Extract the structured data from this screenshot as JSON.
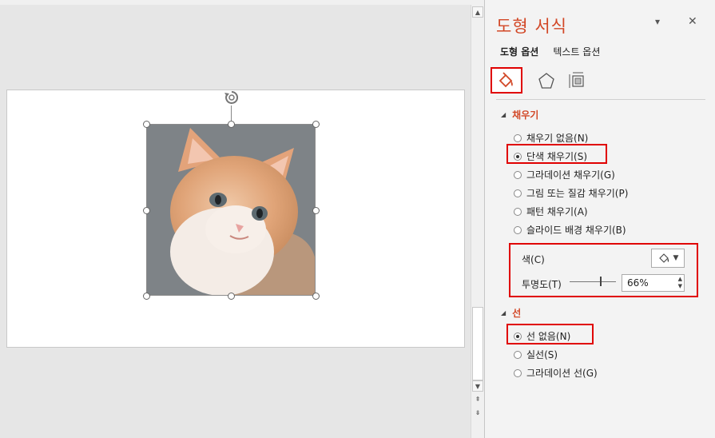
{
  "panel": {
    "title": "도형 서식",
    "dropdown_glyph": "▾",
    "close_glyph": "✕",
    "subtabs": [
      "도형 옵션",
      "텍스트 옵션"
    ],
    "icons": [
      "fill-line-icon",
      "effects-pentagon-icon",
      "size-properties-icon"
    ]
  },
  "fill": {
    "header": "채우기",
    "options": [
      {
        "label": "채우기 없음(N)",
        "selected": false
      },
      {
        "label": "단색 채우기(S)",
        "selected": true
      },
      {
        "label": "그라데이션 채우기(G)",
        "selected": false
      },
      {
        "label": "그림 또는 질감 채우기(P)",
        "selected": false
      },
      {
        "label": "패턴 채우기(A)",
        "selected": false
      },
      {
        "label": "슬라이드 배경 채우기(B)",
        "selected": false
      }
    ],
    "color_label": "색(C)",
    "transparency_label": "투명도(T)",
    "transparency_value": "66%"
  },
  "line": {
    "header": "선",
    "options": [
      {
        "label": "선 없음(N)",
        "selected": true
      },
      {
        "label": "실선(S)",
        "selected": false
      },
      {
        "label": "그라데이션 선(G)",
        "selected": false
      }
    ]
  },
  "colors": {
    "accent": "#d24726",
    "highlight": "#e00000"
  }
}
